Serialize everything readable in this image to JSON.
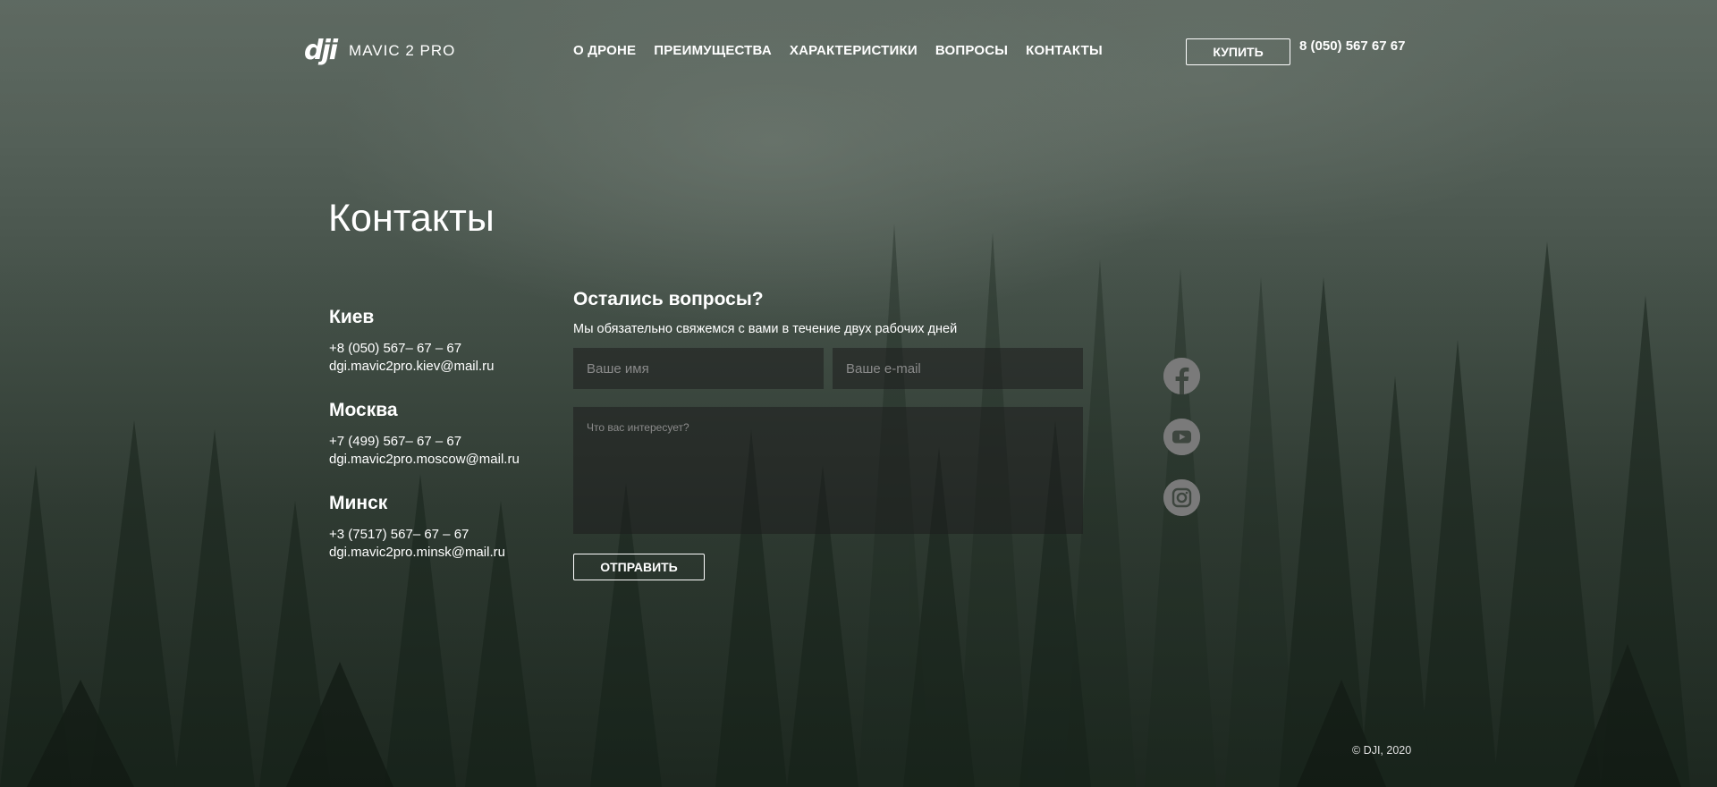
{
  "header": {
    "logo_mark": "dji",
    "logo_text": "MAVIC 2 PRO",
    "nav": [
      "О ДРОНЕ",
      "ПРЕИМУЩЕСТВА",
      "ХАРАКТЕРИСТИКИ",
      "ВОПРОСЫ",
      "КОНТАКТЫ"
    ],
    "buy_label": "КУПИТЬ",
    "phone": "8 (050) 567 67 67"
  },
  "main": {
    "title": "Контакты",
    "cities": [
      {
        "name": "Киев",
        "phone": "+8 (050) 567– 67 – 67",
        "email": "dgi.mavic2pro.kiev@mail.ru"
      },
      {
        "name": "Москва",
        "phone": "+7 (499) 567– 67 – 67",
        "email": "dgi.mavic2pro.moscow@mail.ru"
      },
      {
        "name": "Минск",
        "phone": "+3 (7517) 567– 67 – 67",
        "email": "dgi.mavic2pro.minsk@mail.ru"
      }
    ]
  },
  "form": {
    "title": "Остались вопросы?",
    "subtitle": "Мы обязательно свяжемся с вами в течение двух рабочих дней",
    "name_placeholder": "Ваше имя",
    "email_placeholder": "Ваше e-mail",
    "message_placeholder": "Что вас интересует?",
    "submit_label": "ОТПРАВИТЬ"
  },
  "social": [
    "facebook-icon",
    "youtube-icon",
    "instagram-icon"
  ],
  "footer": {
    "copyright": "© DJI, 2020"
  },
  "colors": {
    "text": "#ffffff",
    "field_bg": "#1e1e1e",
    "social_icon": "#7a7a7a"
  }
}
